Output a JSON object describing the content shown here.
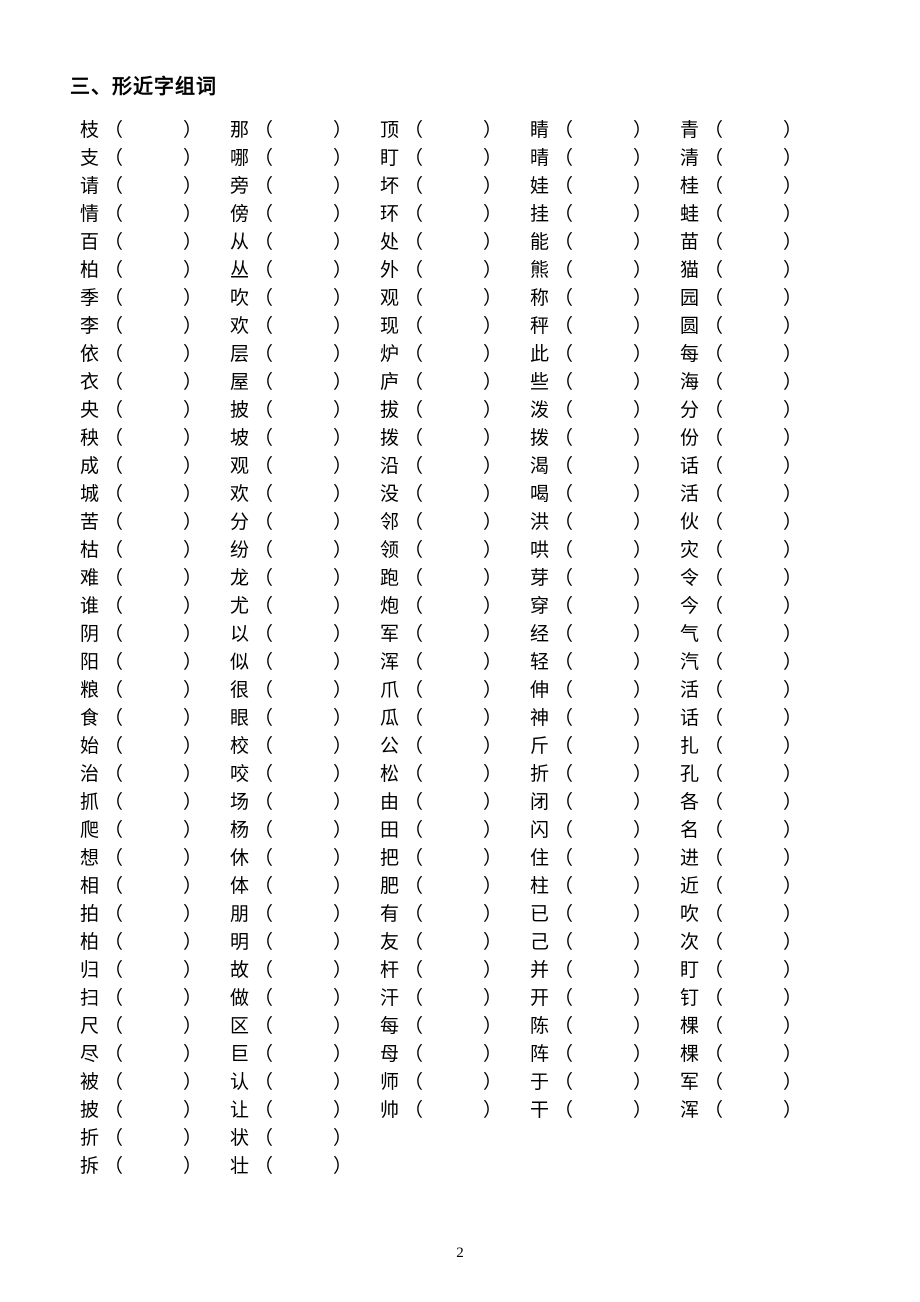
{
  "heading": "三、形近字组词",
  "page_number": "2",
  "columns": [
    [
      "枝",
      "支",
      "请",
      "情",
      "百",
      "柏",
      "季",
      "李",
      "依",
      "衣",
      "央",
      "秧",
      "成",
      "城",
      "苦",
      "枯",
      "难",
      "谁",
      "阴",
      "阳",
      "粮",
      "食",
      "始",
      "治",
      "抓",
      "爬",
      "想",
      "相",
      "拍",
      "柏",
      "归",
      "扫",
      "尺",
      "尽",
      "被",
      "披",
      "折",
      "拆"
    ],
    [
      "那",
      "哪",
      "旁",
      "傍",
      "从",
      "丛",
      "吹",
      "欢",
      "层",
      "屋",
      "披",
      "坡",
      "观",
      "欢",
      "分",
      "纷",
      "龙",
      "尤",
      "以",
      "似",
      "很",
      "眼",
      "校",
      "咬",
      "场",
      "杨",
      "休",
      "体",
      "朋",
      "明",
      "故",
      "做",
      "区",
      "巨",
      "认",
      "让",
      "状",
      "壮"
    ],
    [
      "顶",
      "盯",
      "坏",
      "环",
      "处",
      "外",
      "观",
      "现",
      "炉",
      "庐",
      "拔",
      "拨",
      "沿",
      "没",
      "邻",
      "领",
      "跑",
      "炮",
      "军",
      "浑",
      "爪",
      "瓜",
      "公",
      "松",
      "由",
      "田",
      "把",
      "肥",
      "有",
      "友",
      "杆",
      "汗",
      "每",
      "母",
      "师",
      "帅"
    ],
    [
      "睛",
      "晴",
      "娃",
      "挂",
      "能",
      "熊",
      "称",
      "秤",
      "此",
      "些",
      "泼",
      "拨",
      "渴",
      "喝",
      "洪",
      "哄",
      "芽",
      "穿",
      "经",
      "轻",
      "伸",
      "神",
      "斤",
      "折",
      "闭",
      "闪",
      "住",
      "柱",
      "已",
      "己",
      "并",
      "开",
      "陈",
      "阵",
      "于",
      "干"
    ],
    [
      "青",
      "清",
      "桂",
      "蛙",
      "苗",
      "猫",
      "园",
      "圆",
      "每",
      "海",
      "分",
      "份",
      "话",
      "活",
      "伙",
      "灾",
      "令",
      "今",
      "气",
      "汽",
      "活",
      "话",
      "扎",
      "孔",
      "各",
      "名",
      "进",
      "近",
      "吹",
      "次",
      "盯",
      "钉",
      "棵",
      "棵",
      "军",
      "浑"
    ]
  ]
}
